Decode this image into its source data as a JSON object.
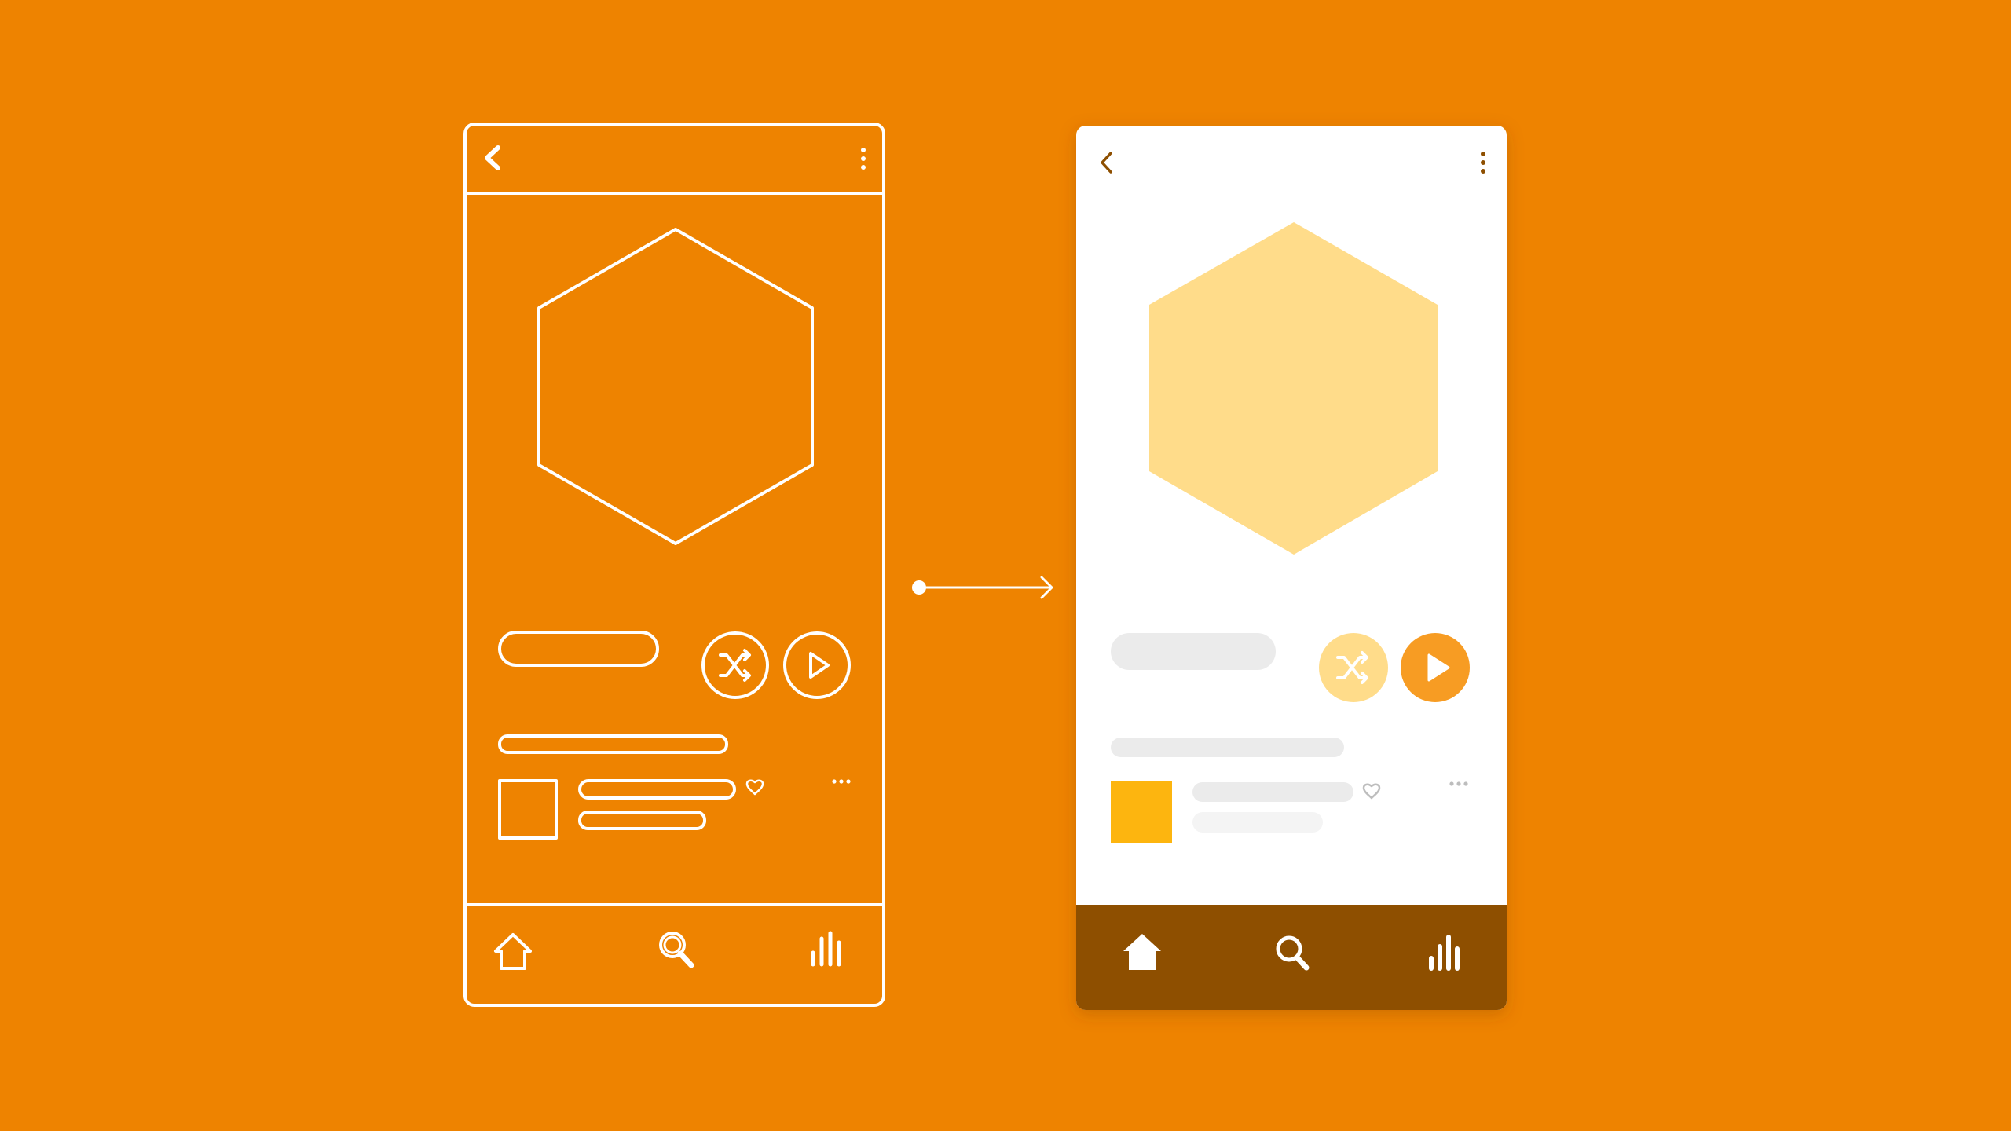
{
  "colors": {
    "background": "#EE8300",
    "wireframe_stroke": "#FFFFFF",
    "card_background": "#FFFFFF",
    "nav_bar": "#8E4F00",
    "artwork": "#FFDC8A",
    "placeholder": "#EBEBEB",
    "placeholder_light": "#F4F4F4",
    "shuffle_button": "#FFDC8A",
    "play_button": "#F79C23",
    "thumbnail": "#FDB50F",
    "icon_dark": "#8E4F00",
    "icon_muted": "#BDBDBD"
  },
  "wireframe": {
    "header": {
      "back_icon": "chevron-left",
      "menu_icon": "vertical-ellipsis"
    },
    "artwork_icon": "hexagon-outline",
    "controls": {
      "shuffle_icon": "shuffle",
      "play_icon": "play-triangle"
    },
    "track": {
      "favorite_icon": "heart",
      "more_icon": "horizontal-ellipsis"
    },
    "nav": [
      "home-icon",
      "search-icon",
      "chart-icon"
    ]
  },
  "transition_arrow": "arrow-right",
  "mockup": {
    "header": {
      "back_icon": "chevron-left",
      "menu_icon": "vertical-ellipsis"
    },
    "artwork_icon": "hexagon-filled",
    "controls": {
      "shuffle_icon": "shuffle",
      "play_icon": "play-triangle"
    },
    "track": {
      "favorite_icon": "heart",
      "more_icon": "horizontal-ellipsis"
    },
    "nav": [
      "home-icon",
      "search-icon",
      "chart-icon"
    ]
  }
}
